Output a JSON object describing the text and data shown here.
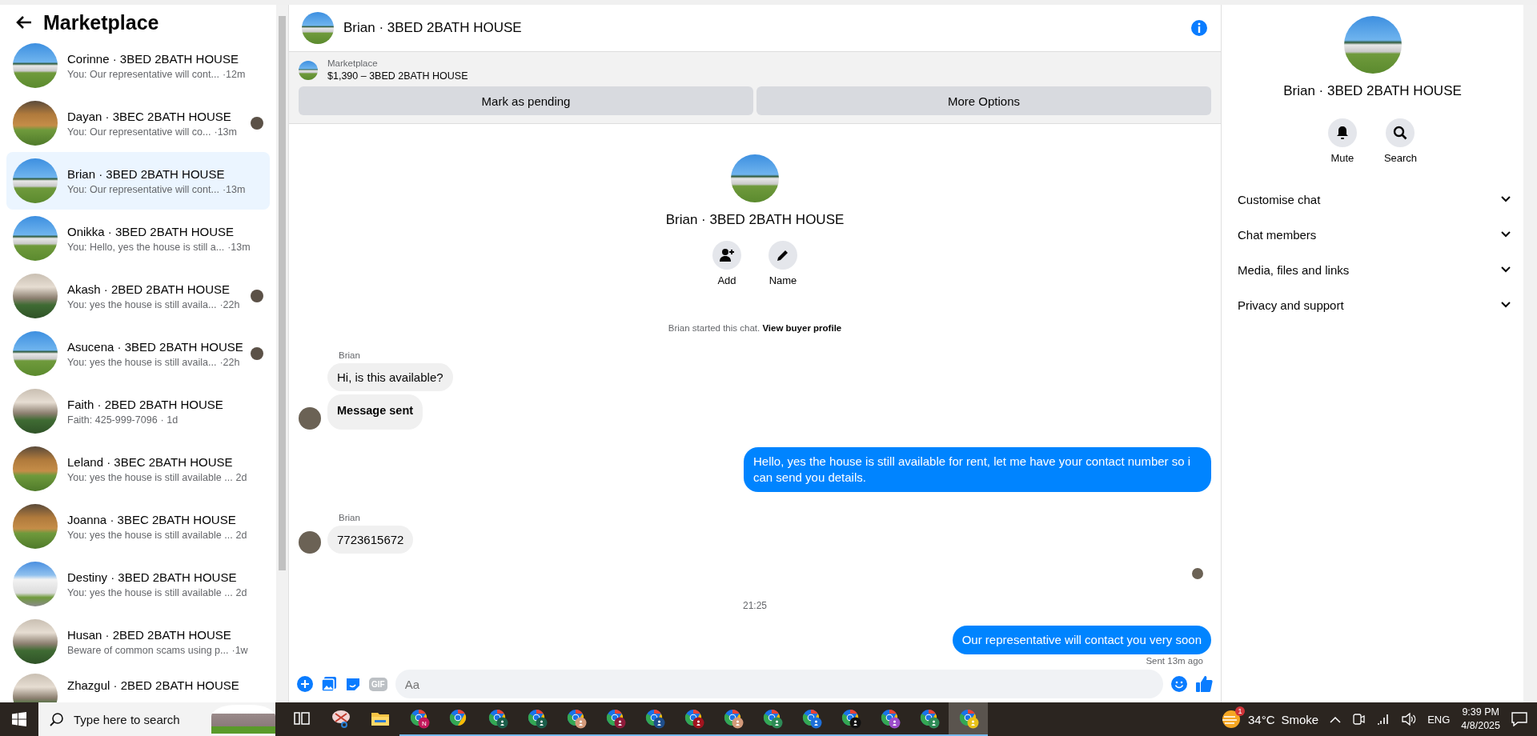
{
  "sidebar": {
    "title": "Marketplace",
    "conversations": [
      {
        "name": "Corinne · 3BED 2BATH HOUSE",
        "preview": "You: Our representative will cont...",
        "time": "·12m",
        "kind": "ranch",
        "seen_avatar": false,
        "selected": false
      },
      {
        "name": "Dayan · 3BEC 2BATH HOUSE",
        "preview": "You: Our representative will co...",
        "time": "·13m",
        "kind": "cabin",
        "seen_avatar": true,
        "selected": false
      },
      {
        "name": "Brian · 3BED 2BATH HOUSE",
        "preview": "You: Our representative will cont...",
        "time": "·13m",
        "kind": "ranch",
        "seen_avatar": false,
        "selected": true
      },
      {
        "name": "Onikka · 3BED 2BATH HOUSE",
        "preview": "You: Hello, yes the house is still a...",
        "time": "·13m",
        "kind": "ranch",
        "seen_avatar": false,
        "selected": false
      },
      {
        "name": "Akash · 2BED 2BATH HOUSE",
        "preview": "You: yes the house is still availa...",
        "time": "·22h",
        "kind": "apartment",
        "seen_avatar": true,
        "selected": false
      },
      {
        "name": "Asucena · 3BED 2BATH HOUSE",
        "preview": "You: yes the house is still availa...",
        "time": "·22h",
        "kind": "ranch",
        "seen_avatar": true,
        "selected": false
      },
      {
        "name": "Faith · 2BED 2BATH HOUSE",
        "preview": "Faith: 425-999-7096",
        "time": "· 1d",
        "kind": "apartment",
        "seen_avatar": false,
        "selected": false
      },
      {
        "name": "Leland · 3BEC 2BATH HOUSE",
        "preview": "You: yes the house is still available ...",
        "time": "2d",
        "kind": "cabin",
        "seen_avatar": false,
        "selected": false
      },
      {
        "name": "Joanna · 3BEC 2BATH HOUSE",
        "preview": "You: yes the house is still available ...",
        "time": "2d",
        "kind": "cabin",
        "seen_avatar": false,
        "selected": false
      },
      {
        "name": "Destiny · 3BED 2BATH HOUSE",
        "preview": "You: yes the house is still available ...",
        "time": "2d",
        "kind": "cottage",
        "seen_avatar": false,
        "selected": false
      },
      {
        "name": "Husan · 2BED 2BATH HOUSE",
        "preview": "Beware of common scams using p...",
        "time": "·1w",
        "kind": "apartment",
        "seen_avatar": false,
        "selected": false
      },
      {
        "name": "Zhazgul · 2BED 2BATH HOUSE",
        "kind": "apartment",
        "seen_avatar": false,
        "selected": false
      }
    ]
  },
  "chat": {
    "title": "Brian · 3BED 2BATH HOUSE",
    "listing": {
      "label": "Marketplace",
      "price_title": "$1,390 – 3BED 2BATH HOUSE",
      "buttons": [
        "Mark as pending",
        "More Options"
      ]
    },
    "intro": {
      "name": "Brian · 3BED 2BATH HOUSE",
      "actions": [
        {
          "kind": "add",
          "label": "Add"
        },
        {
          "kind": "name",
          "label": "Name"
        }
      ]
    },
    "messages": [
      {
        "kind": "system",
        "text": "Brian started this chat. **View buyer profile**"
      },
      {
        "kind": "sender",
        "text": "Brian"
      },
      {
        "kind": "incoming",
        "text": "Hi, is this available?",
        "avatar": false
      },
      {
        "kind": "incoming-bold",
        "text": "Message sent",
        "avatar": true
      },
      {
        "kind": "outgoing",
        "text": "Hello, yes the house is still available for rent, let me have your contact number so i can send you details."
      },
      {
        "kind": "sender",
        "text": "Brian"
      },
      {
        "kind": "incoming",
        "text": "7723615672",
        "avatar": true
      },
      {
        "kind": "seen"
      },
      {
        "kind": "timestamp",
        "text": "21:25"
      },
      {
        "kind": "outgoing",
        "text": "Our representative will contact you very soon"
      },
      {
        "kind": "status",
        "text": "Sent 13m ago"
      }
    ],
    "composer": {
      "gif": "GIF",
      "placeholder": "Aa"
    }
  },
  "details": {
    "name": "Brian · 3BED 2BATH HOUSE",
    "actions": [
      {
        "kind": "mute",
        "label": "Mute"
      },
      {
        "kind": "search",
        "label": "Search"
      }
    ],
    "sections": [
      {
        "label": "Customise chat",
        "expanded": false
      },
      {
        "label": "Chat members",
        "expanded": false
      },
      {
        "label": "Media, files and links",
        "expanded": false
      },
      {
        "label": "Privacy and support",
        "expanded": false
      }
    ]
  },
  "taskbar": {
    "search_placeholder": "Type here to search",
    "apps": [
      {
        "kind": "task-view",
        "selected": false
      },
      {
        "kind": "snip",
        "selected": false
      },
      {
        "kind": "folder",
        "selected": false
      },
      {
        "kind": "chrome",
        "badge": "N",
        "color": "#c2185b",
        "selected": false
      },
      {
        "kind": "chrome",
        "selected": false
      },
      {
        "kind": "chrome",
        "color": "#1b5e4a",
        "selected": false
      },
      {
        "kind": "chrome",
        "color": "#1b5e4a",
        "selected": false
      },
      {
        "kind": "chrome",
        "color": "#d39a7a",
        "selected": false
      },
      {
        "kind": "chrome",
        "color": "#8e1b3a",
        "selected": false
      },
      {
        "kind": "chrome",
        "color": "#1e4e8c",
        "selected": false
      },
      {
        "kind": "chrome",
        "color": "#a1141e",
        "selected": false
      },
      {
        "kind": "chrome",
        "color": "#d39a7a",
        "selected": false
      },
      {
        "kind": "chrome",
        "color": "#2e8b57",
        "selected": false
      },
      {
        "kind": "chrome",
        "color": "#1e6fd9",
        "selected": false
      },
      {
        "kind": "chrome",
        "color": "#111111",
        "selected": false
      },
      {
        "kind": "chrome",
        "color": "#9b4dca",
        "selected": false
      },
      {
        "kind": "chrome",
        "color": "#2e8b57",
        "selected": false
      },
      {
        "kind": "chrome",
        "color": "#e8c21a",
        "selected": true
      }
    ],
    "weather": {
      "badge": "1",
      "temp": "34°C",
      "condition": "Smoke"
    },
    "language": "ENG",
    "time": "9:39 PM",
    "date": "4/8/2025"
  }
}
